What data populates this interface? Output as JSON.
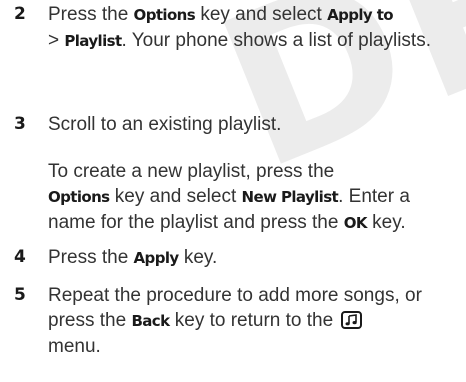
{
  "watermark": "DRAFT",
  "steps": [
    {
      "number": "2",
      "t1": "Press the ",
      "k1": "Options",
      "t2": " key and select ",
      "k2": "Apply to",
      "t3": "> ",
      "k3": "Playlist",
      "t4": ". Your phone shows a list of playlists."
    },
    {
      "number": "3",
      "t1": "Scroll to an existing playlist."
    },
    {
      "t1": "To create a new playlist, press the ",
      "k1": "Options",
      "t2": " key and select ",
      "k2": "New Playlist",
      "t3": ". Enter a name for the playlist and press the ",
      "k3": "OK",
      "t4": " key."
    },
    {
      "number": "4",
      "t1": "Press the ",
      "k1": "Apply",
      "t2": " key."
    },
    {
      "number": "5",
      "t1": "Repeat the procedure to add more songs, or press the ",
      "k1": "Back",
      "t2": " key to return to the ",
      "icon": "music-menu-icon",
      "t3": " menu."
    }
  ]
}
